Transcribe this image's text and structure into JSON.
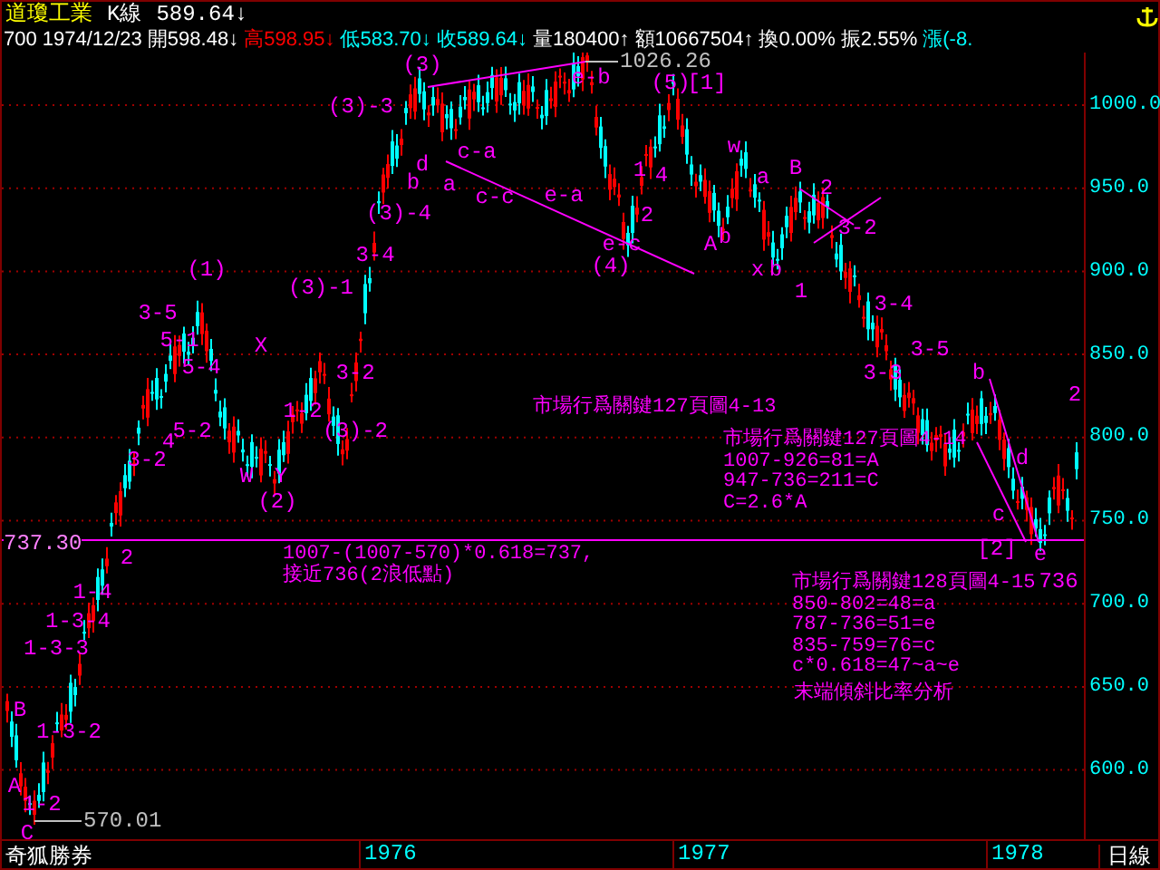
{
  "header": {
    "title": "道瓊工業",
    "chart_type": "K線",
    "price": "589.64↓"
  },
  "quote": [
    {
      "text": "700",
      "color": "#ffffff"
    },
    {
      "text": "1974/12/23",
      "color": "#ffffff"
    },
    {
      "text": "開598.48↓",
      "color": "#ffffff"
    },
    {
      "text": "高598.95↓",
      "color": "#ff0000"
    },
    {
      "text": "低583.70↓",
      "color": "#00ffff"
    },
    {
      "text": "收589.64↓",
      "color": "#00ffff"
    },
    {
      "text": "量180400↑",
      "color": "#ffffff"
    },
    {
      "text": "額10667504↑",
      "color": "#ffffff"
    },
    {
      "text": "換0.00%",
      "color": "#ffffff"
    },
    {
      "text": "振2.55%",
      "color": "#ffffff"
    },
    {
      "text": "漲(-8.",
      "color": "#00ffff"
    }
  ],
  "y_axis": [
    "1000.0",
    "950.0",
    "900.0",
    "850.0",
    "800.0",
    "750.0",
    "700.0",
    "650.0",
    "600.0"
  ],
  "high_label": "1026.26",
  "low_label": "570.01",
  "level_line_label": "737.30",
  "wave_labels": [
    "(3)",
    "(3)-3",
    "(3)-4",
    "3-4",
    "(3)-1",
    "(1)",
    "3-5",
    "5-1",
    "5-4",
    "3-2",
    "(3)-2",
    "1-2",
    "X",
    "W",
    "Y",
    "(2)",
    "5-2",
    "3-2",
    "4",
    "1-4",
    "1-3-4",
    "1-3-3",
    "1-3-2",
    "1-2",
    "B",
    "A",
    "C",
    "2",
    "(4)",
    "e-c",
    "c-c",
    "e-a",
    "c-a",
    "b",
    "a",
    "d",
    "e-b",
    "(5)",
    "[1]",
    "4",
    "2",
    "1",
    "A",
    "b",
    "x",
    "b",
    "1",
    "w",
    "a",
    "B",
    "2",
    "3-2",
    "3-4",
    "3-3",
    "3-5",
    "b",
    "d",
    "c",
    "[2]",
    "e",
    "2",
    "736"
  ],
  "notes": [
    {
      "lines": [
        "市場行爲關鍵127頁圖4-13"
      ]
    },
    {
      "lines": [
        "市場行爲關鍵127頁圖4-14",
        "1007-926=81=A",
        "947-736=211=C",
        "C=2.6*A"
      ]
    },
    {
      "lines": [
        "1007-(1007-570)*0.618=737,",
        "接近736(2浪低點)"
      ]
    },
    {
      "lines": [
        "市場行爲關鍵128頁圖4-15",
        "850-802=48=a",
        "787-736=51=e",
        "835-759=76=c",
        "c*0.618=47~a~e"
      ]
    },
    {
      "lines": [
        "末端傾斜比率分析"
      ]
    }
  ],
  "footer": {
    "source": "奇狐勝券",
    "years": [
      "1976",
      "1977",
      "1978"
    ],
    "period": "日線"
  }
}
